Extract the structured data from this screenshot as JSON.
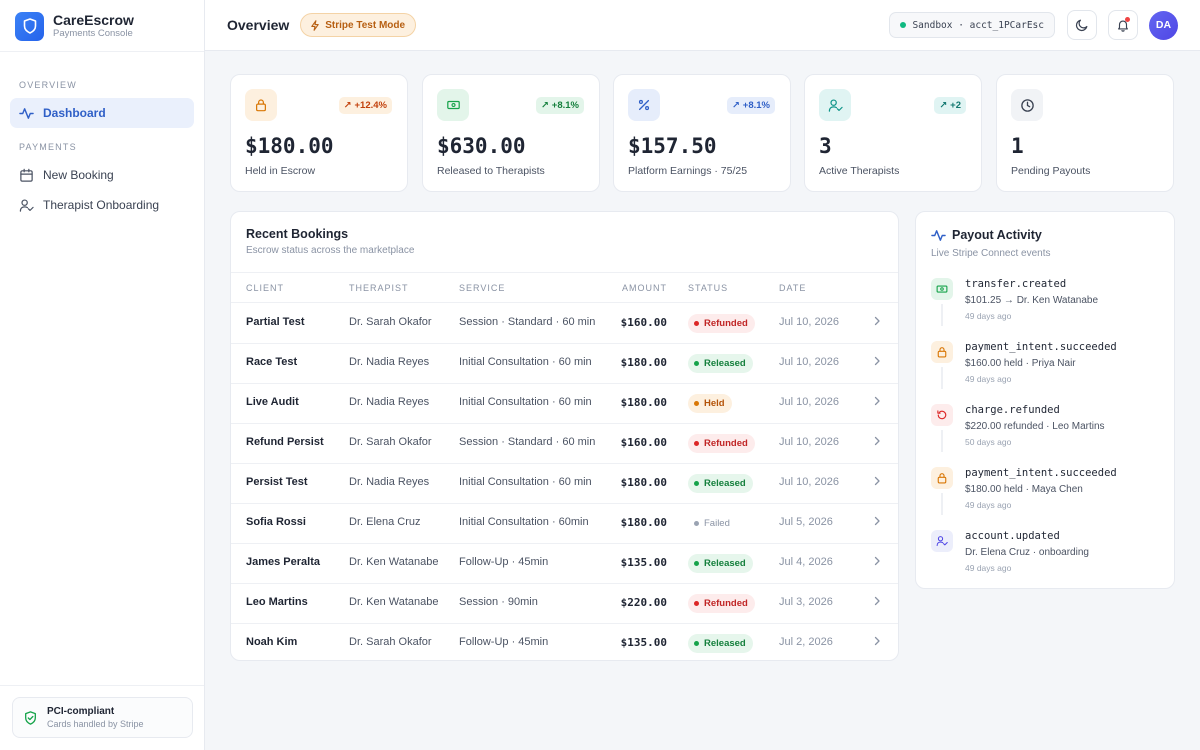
{
  "brand": {
    "name": "CareEscrow",
    "subtitle": "Payments Console"
  },
  "sidebar": {
    "sections": [
      {
        "label": "OVERVIEW",
        "items": [
          {
            "label": "Dashboard",
            "icon": "activity-icon",
            "active": true
          }
        ]
      },
      {
        "label": "PAYMENTS",
        "items": [
          {
            "label": "New Booking",
            "icon": "calendar-icon"
          },
          {
            "label": "Therapist Onboarding",
            "icon": "user-check-icon"
          }
        ]
      }
    ],
    "footer": {
      "title": "PCI-compliant",
      "subtitle": "Cards handled by Stripe"
    }
  },
  "header": {
    "title": "Overview",
    "mode_badge": "Stripe Test Mode",
    "account": "Sandbox · acct_1PCarEsc",
    "avatar_initials": "DA"
  },
  "stats": [
    {
      "value": "$180.00",
      "label": "Held in Escrow",
      "delta": "+12.4%",
      "icon": "lock-icon",
      "tone": "amber"
    },
    {
      "value": "$630.00",
      "label": "Released to Therapists",
      "delta": "+8.1%",
      "icon": "banknote-icon",
      "tone": "green"
    },
    {
      "value": "$157.50",
      "label": "Platform Earnings · 75/25",
      "delta": "+8.1%",
      "icon": "percent-icon",
      "tone": "blue"
    },
    {
      "value": "3",
      "label": "Active Therapists",
      "delta": "+2",
      "icon": "user-check-icon",
      "tone": "teal"
    },
    {
      "value": "1",
      "label": "Pending Payouts",
      "delta": "",
      "icon": "clock-icon",
      "tone": "gray"
    }
  ],
  "bookings": {
    "title": "Recent Bookings",
    "subtitle": "Escrow status across the marketplace",
    "columns": [
      "CLIENT",
      "THERAPIST",
      "SERVICE",
      "AMOUNT",
      "STATUS",
      "DATE"
    ],
    "rows": [
      {
        "client": "Partial Test",
        "therapist": "Dr. Sarah Okafor",
        "service": "Session · Standard · 60 min",
        "amount": "$160.00",
        "status": "Refunded",
        "date": "Jul 10, 2026"
      },
      {
        "client": "Race Test",
        "therapist": "Dr. Nadia Reyes",
        "service": "Initial Consultation · 60 min",
        "amount": "$180.00",
        "status": "Released",
        "date": "Jul 10, 2026"
      },
      {
        "client": "Live Audit",
        "therapist": "Dr. Nadia Reyes",
        "service": "Initial Consultation · 60 min",
        "amount": "$180.00",
        "status": "Held",
        "date": "Jul 10, 2026"
      },
      {
        "client": "Refund Persist",
        "therapist": "Dr. Sarah Okafor",
        "service": "Session · Standard · 60 min",
        "amount": "$160.00",
        "status": "Refunded",
        "date": "Jul 10, 2026"
      },
      {
        "client": "Persist Test",
        "therapist": "Dr. Nadia Reyes",
        "service": "Initial Consultation · 60 min",
        "amount": "$180.00",
        "status": "Released",
        "date": "Jul 10, 2026"
      },
      {
        "client": "Sofia Rossi",
        "therapist": "Dr. Elena Cruz",
        "service": "Initial Consultation · 60min",
        "amount": "$180.00",
        "status": "Failed",
        "date": "Jul 5, 2026"
      },
      {
        "client": "James Peralta",
        "therapist": "Dr. Ken Watanabe",
        "service": "Follow-Up · 45min",
        "amount": "$135.00",
        "status": "Released",
        "date": "Jul 4, 2026"
      },
      {
        "client": "Leo Martins",
        "therapist": "Dr. Ken Watanabe",
        "service": "Session · 90min",
        "amount": "$220.00",
        "status": "Refunded",
        "date": "Jul 3, 2026"
      },
      {
        "client": "Noah Kim",
        "therapist": "Dr. Sarah Okafor",
        "service": "Follow-Up · 45min",
        "amount": "$135.00",
        "status": "Released",
        "date": "Jul 2, 2026"
      }
    ]
  },
  "payouts": {
    "title": "Payout Activity",
    "subtitle": "Live Stripe Connect events",
    "events": [
      {
        "name": "transfer.created",
        "desc": "$101.25 → Dr. Ken Watanabe",
        "time": "49 days ago",
        "icon": "banknote-icon",
        "tone": "green"
      },
      {
        "name": "payment_intent.succeeded",
        "desc": "$160.00 held · Priya Nair",
        "time": "49 days ago",
        "icon": "lock-icon",
        "tone": "amber"
      },
      {
        "name": "charge.refunded",
        "desc": "$220.00 refunded · Leo Martins",
        "time": "50 days ago",
        "icon": "rotate-ccw-icon",
        "tone": "red"
      },
      {
        "name": "payment_intent.succeeded",
        "desc": "$180.00 held · Maya Chen",
        "time": "49 days ago",
        "icon": "lock-icon",
        "tone": "amber"
      },
      {
        "name": "account.updated",
        "desc": "Dr. Elena Cruz · onboarding",
        "time": "49 days ago",
        "icon": "user-check-icon",
        "tone": "indigo"
      }
    ]
  },
  "colors": {
    "accent": "#2f5fc7",
    "held": "#d97706",
    "released": "#16a34a",
    "refunded": "#dc2626"
  }
}
